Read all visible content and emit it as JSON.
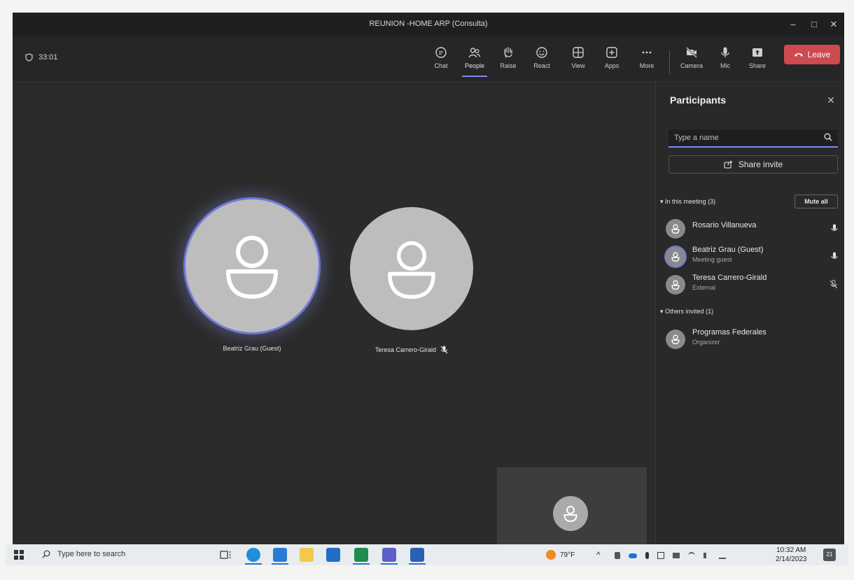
{
  "window": {
    "title": "REUNION -HOME ARP (Consulta)"
  },
  "meeting": {
    "timer": "33:01"
  },
  "toolbar": {
    "buttons": [
      {
        "label": "Chat",
        "icon": "chat-icon"
      },
      {
        "label": "People",
        "icon": "people-icon",
        "active": true
      },
      {
        "label": "Raise",
        "icon": "raise-hand-icon"
      },
      {
        "label": "React",
        "icon": "react-icon"
      },
      {
        "label": "View",
        "icon": "view-icon"
      },
      {
        "label": "Apps",
        "icon": "apps-icon"
      },
      {
        "label": "More",
        "icon": "more-icon"
      },
      {
        "label": "Camera",
        "icon": "camera-off-icon"
      },
      {
        "label": "Mic",
        "icon": "mic-icon"
      },
      {
        "label": "Share",
        "icon": "share-icon"
      }
    ],
    "leave_label": "Leave"
  },
  "stage": {
    "tiles": [
      {
        "name": "Beatriz Grau (Guest)",
        "speaking": true
      },
      {
        "name": "Teresa Carrero-Girald",
        "muted": true
      }
    ]
  },
  "participants_panel": {
    "title": "Participants",
    "search_placeholder": "Type a name",
    "share_invite_label": "Share invite",
    "in_meeting_header": "In this meeting (3)",
    "mute_all_label": "Mute all",
    "in_meeting": [
      {
        "name": "Rosario Villanueva",
        "subtitle": "",
        "mic": "on"
      },
      {
        "name": "Beatriz Grau (Guest)",
        "subtitle": "Meeting guest",
        "mic": "on",
        "speaking": true
      },
      {
        "name": "Teresa Carrero-Girald",
        "subtitle": "External",
        "mic": "muted"
      }
    ],
    "others_header": "Others invited (1)",
    "others": [
      {
        "name": "Programas Federales",
        "subtitle": "Organizer"
      }
    ]
  },
  "taskbar": {
    "search_placeholder": "Type here to search",
    "weather": "79°F",
    "time": "10:32 AM",
    "date": "2/14/2023",
    "notifications": "21"
  },
  "colors": {
    "accent": "#7f85f5",
    "leave": "#cc4a50",
    "stage_bg": "#2b2b2b"
  }
}
